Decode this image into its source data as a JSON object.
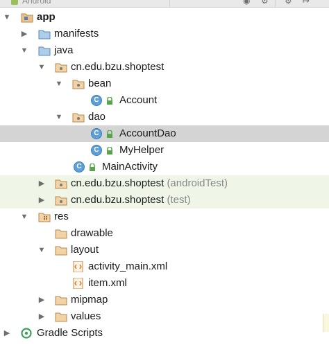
{
  "header": {
    "label": "Android",
    "icons": [
      "android-icon",
      "target-icon",
      "settings-split-icon",
      "gear-icon",
      "collapse-icon"
    ]
  },
  "colors": {
    "folder": "#d6a86b",
    "package_dot": "#7a7a7a",
    "class_badge": "#5da0d8",
    "lock": "#57a64a",
    "selected_row": "#d4d4d4",
    "test_row": "#eff6e7"
  },
  "tree": {
    "app": "app",
    "manifests": "manifests",
    "java": "java",
    "package_main": "cn.edu.bzu.shoptest",
    "bean": "bean",
    "account": "Account",
    "dao": "dao",
    "account_dao": "AccountDao",
    "my_helper": "MyHelper",
    "main_activity": "MainActivity",
    "package_android_test": "cn.edu.bzu.shoptest",
    "package_android_test_suffix": "(androidTest)",
    "package_test": "cn.edu.bzu.shoptest",
    "package_test_suffix": "(test)",
    "res": "res",
    "drawable": "drawable",
    "layout": "layout",
    "activity_main_xml": "activity_main.xml",
    "item_xml": "item.xml",
    "mipmap": "mipmap",
    "values": "values",
    "gradle_scripts": "Gradle Scripts"
  },
  "class_badge_letter": "C"
}
